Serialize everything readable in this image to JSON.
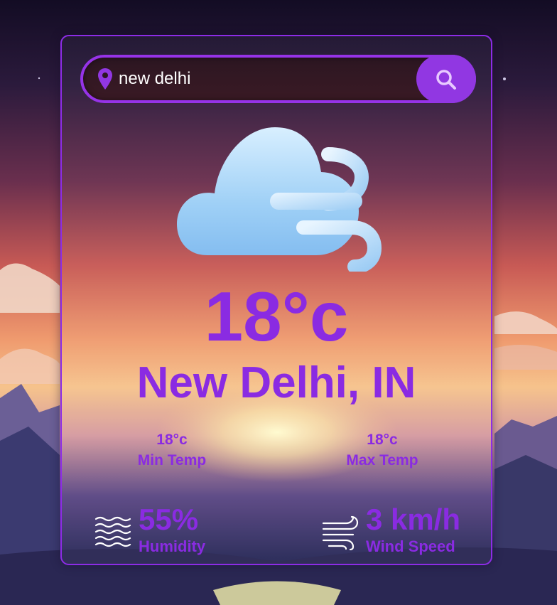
{
  "search": {
    "value": "new delhi",
    "placeholder": ""
  },
  "weather": {
    "icon": "windy-cloud-icon",
    "temperature": "18°c",
    "location": "New Delhi, IN",
    "min": {
      "value": "18°c",
      "label": "Min Temp"
    },
    "max": {
      "value": "18°c",
      "label": "Max Temp"
    },
    "humidity": {
      "value": "55%",
      "label": "Humidity",
      "icon": "waves-icon"
    },
    "wind": {
      "value": "3 km/h",
      "label": "Wind Speed",
      "icon": "wind-icon"
    }
  },
  "colors": {
    "accent": "#8a2be2",
    "button": "#9137e2",
    "card_border": "#8d2ce6"
  }
}
